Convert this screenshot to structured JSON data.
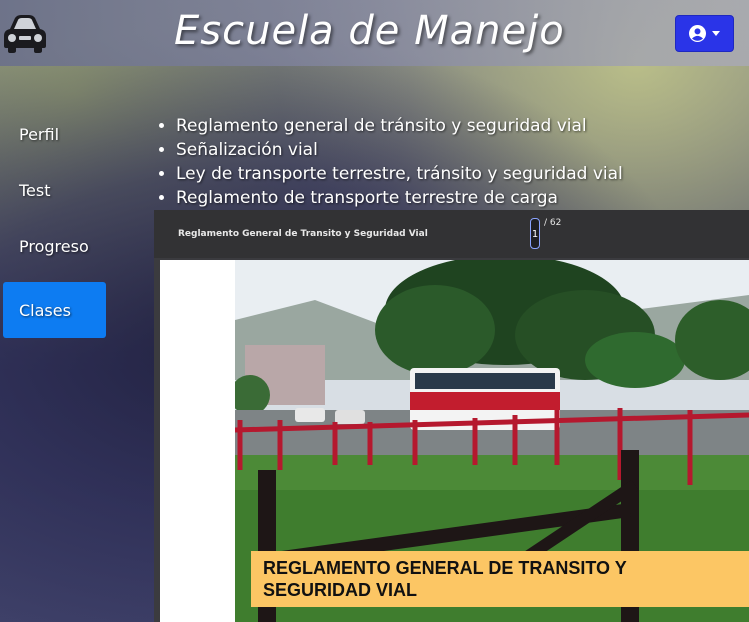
{
  "header": {
    "title": "Escuela de Manejo",
    "logo_icon": "car-icon",
    "user_menu_icon": "user-circle-icon",
    "accent": "#2a34e8"
  },
  "sidebar": {
    "items": [
      {
        "label": "Perfil",
        "active": false
      },
      {
        "label": "Test",
        "active": false
      },
      {
        "label": "Progreso",
        "active": false
      },
      {
        "label": "Clases",
        "active": true
      }
    ],
    "active_color": "#0d7cf2"
  },
  "topics": [
    "Reglamento general de tránsito y seguridad vial",
    "Señalización vial",
    "Ley de transporte terrestre, tránsito y seguridad vial",
    "Reglamento de transporte terrestre de carga"
  ],
  "pdf_viewer": {
    "document_title": "Reglamento General de Transito y Seguridad Vial",
    "current_page": "1",
    "total_pages": "/ 62",
    "page_caption": "REGLAMENTO GENERAL DE TRANSITO Y SEGURIDAD VIAL",
    "caption_color": "#fcc664"
  }
}
